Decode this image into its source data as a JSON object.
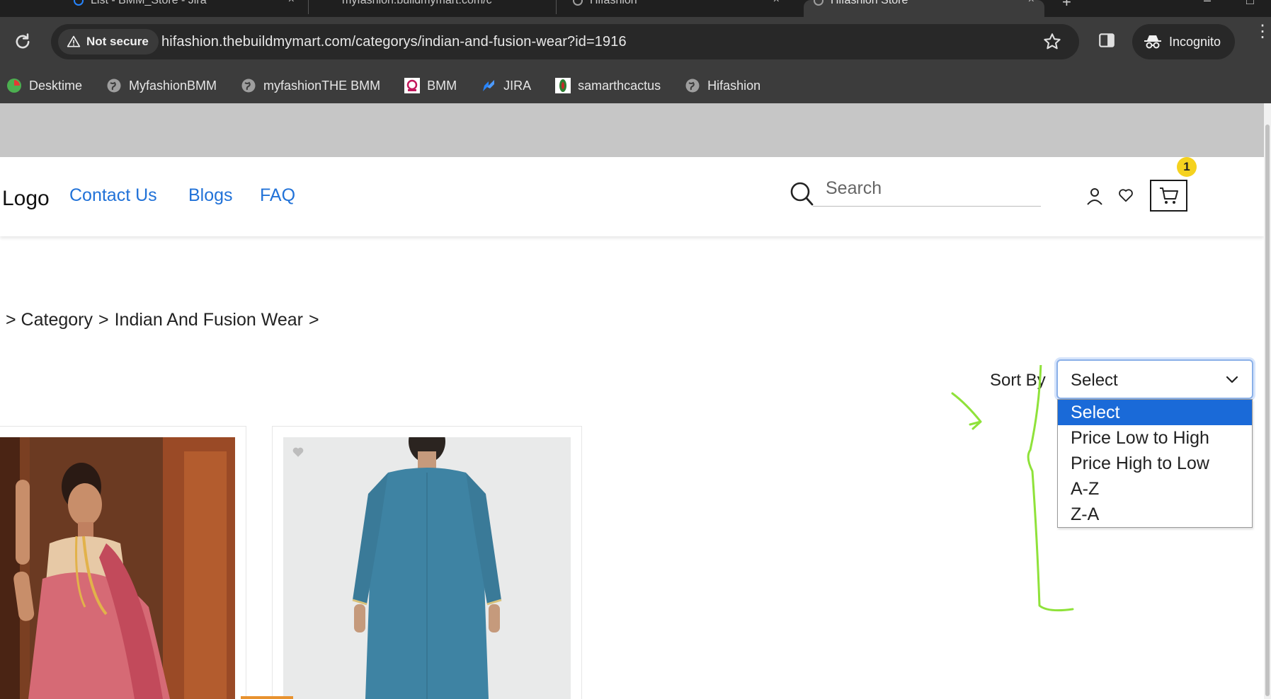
{
  "browser": {
    "tabs": [
      {
        "label": "List - BMM_Store - Jira"
      },
      {
        "label": "myfashion.buildmymart.com/c"
      },
      {
        "label": "Hifashion"
      },
      {
        "label": "Hifashion Store"
      }
    ],
    "security_label": "Not secure",
    "url": "hifashion.thebuildmymart.com/categorys/indian-and-fusion-wear?id=1916",
    "profile_label": "Incognito",
    "bookmarks": [
      {
        "label": "Desktime",
        "icon": "desktime-icon"
      },
      {
        "label": "MyfashionBMM",
        "icon": "globe-icon"
      },
      {
        "label": "myfashionTHE BMM",
        "icon": "globe-icon"
      },
      {
        "label": "BMM",
        "icon": "bmm-icon"
      },
      {
        "label": "JIRA",
        "icon": "jira-icon"
      },
      {
        "label": "samarthcactus",
        "icon": "cactus-icon"
      },
      {
        "label": "Hifashion",
        "icon": "globe-icon"
      }
    ]
  },
  "header": {
    "logo": "Logo",
    "nav": [
      "Contact Us",
      "Blogs",
      "FAQ"
    ],
    "search_placeholder": "Search",
    "cart_count": "1"
  },
  "breadcrumb": [
    "> Category",
    ">",
    "Indian And Fusion Wear",
    ">"
  ],
  "sort": {
    "label": "Sort By",
    "selected": "Select",
    "options": [
      "Select",
      "Price Low to High",
      "Price High to Low",
      "A-Z",
      "Z-A"
    ]
  },
  "colors": {
    "link": "#2172d8",
    "selected_option": "#1a6ad8",
    "cart_badge": "#f5d21f",
    "annotation": "#8fe23a"
  }
}
